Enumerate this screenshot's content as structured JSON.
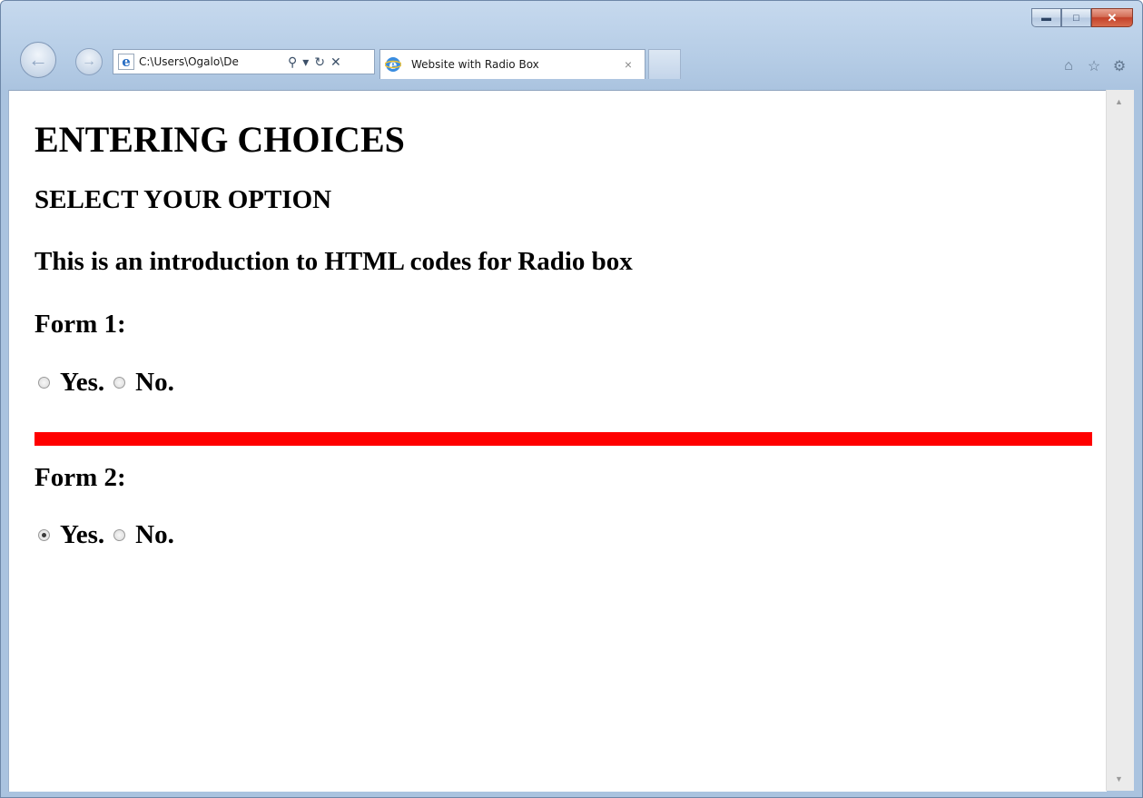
{
  "browser": {
    "address": "C:\\Users\\Ogalo\\De",
    "tab_title": "Website with Radio Box",
    "tab_close": "×",
    "window_controls": [
      "minimize",
      "maximize",
      "close"
    ],
    "icons": [
      "back-icon",
      "forward-icon",
      "ie-icon",
      "search-icon",
      "dropdown-icon",
      "refresh-icon",
      "stop-icon",
      "home-icon",
      "favorites-icon",
      "tools-icon"
    ]
  },
  "page": {
    "heading": "ENTERING CHOICES",
    "subheading": "SELECT YOUR OPTION",
    "intro": "This is an introduction to HTML codes for Radio box",
    "form1": {
      "label": "Form 1:",
      "options": [
        {
          "label": "Yes.",
          "checked": false
        },
        {
          "label": "No.",
          "checked": false
        }
      ]
    },
    "divider_color": "#ff0000",
    "form2": {
      "label": "Form 2:",
      "options": [
        {
          "label": "Yes.",
          "checked": true
        },
        {
          "label": "No.",
          "checked": false
        }
      ]
    }
  }
}
